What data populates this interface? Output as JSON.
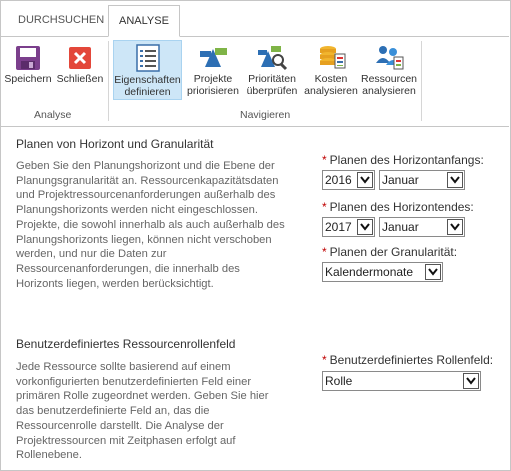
{
  "tabs": [
    {
      "label": "DURCHSUCHEN"
    },
    {
      "label": "ANALYSE"
    }
  ],
  "ribbon": {
    "groups": [
      {
        "label": "Analyse",
        "buttons": [
          {
            "label": "Speichern",
            "icon": "save-icon"
          },
          {
            "label": "Schließen",
            "icon": "close-icon"
          }
        ]
      },
      {
        "label": "Navigieren",
        "buttons": [
          {
            "line1": "Eigenschaften",
            "line2": "definieren",
            "icon": "properties-list-icon",
            "selected": true
          },
          {
            "line1": "Projekte",
            "line2": "priorisieren",
            "icon": "prioritize-projects-icon"
          },
          {
            "line1": "Prioritäten",
            "line2": "überprüfen",
            "icon": "review-priorities-icon"
          },
          {
            "line1": "Kosten",
            "line2": "analysieren",
            "icon": "analyze-costs-icon"
          },
          {
            "line1": "Ressourcen",
            "line2": "analysieren",
            "icon": "analyze-resources-icon"
          }
        ]
      }
    ]
  },
  "horizon": {
    "title": "Planen von Horizont und Granularität",
    "description": "Geben Sie den Planungshorizont und die Ebene der Planungsgranularität an. Ressourcenkapazitätsdaten und Projektressourcenanforderungen außerhalb des Planungshorizonts werden nicht eingeschlossen. Projekte, die sowohl innerhalb als auch außerhalb des Planungshorizonts liegen, können nicht verschoben werden, und nur die Daten zur Ressourcenanforderungen, die innerhalb des Horizonts liegen, werden berücksichtigt.",
    "start_label": "Planen des Horizontanfangs:",
    "start_year": "2016",
    "start_month": "Januar",
    "end_label": "Planen des Horizontendes:",
    "end_year": "2017",
    "end_month": "Januar",
    "granularity_label": "Planen der Granularität:",
    "granularity_value": "Kalendermonate"
  },
  "role": {
    "title": "Benutzerdefiniertes Ressourcenrollenfeld",
    "description": "Jede Ressource sollte basierend auf einem vorkonfigurierten benutzerdefinierten Feld einer primären Rolle zugeordnet werden. Geben Sie hier das benutzerdefinierte Feld an, das die Ressourcenrolle darstellt. Die Analyse der Projektressourcen mit Zeitphasen erfolgt auf Rollenebene.",
    "field_label": "Benutzerdefiniertes Rollenfeld:",
    "field_value": "Rolle"
  },
  "required_marker": "*"
}
